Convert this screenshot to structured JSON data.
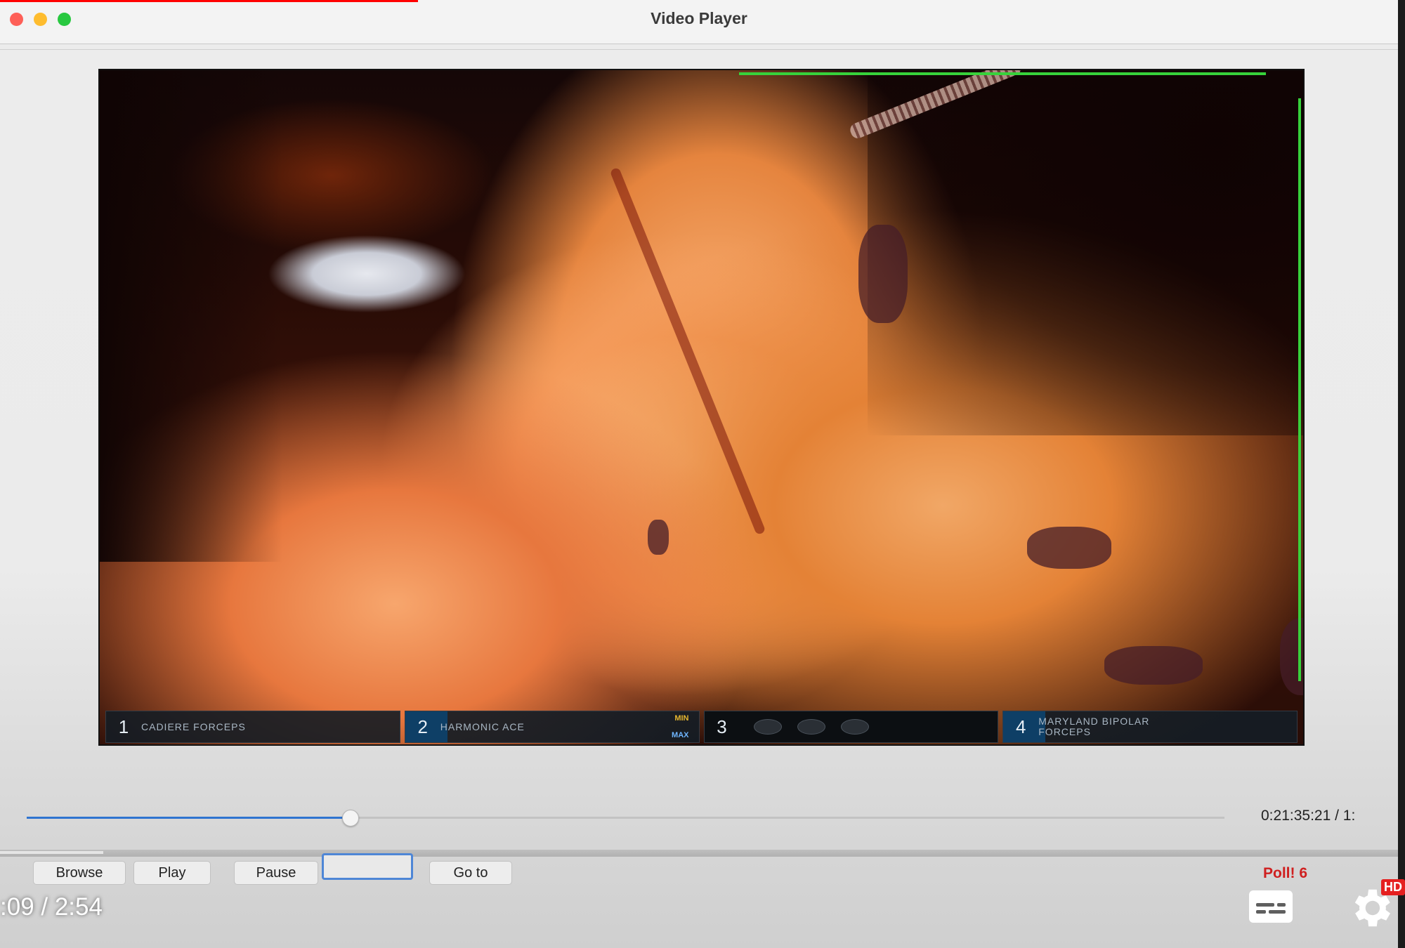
{
  "window": {
    "title": "Video Player"
  },
  "video": {
    "hud": [
      {
        "num": "1",
        "name": "CADIERE FORCEPS"
      },
      {
        "num": "2",
        "name": "HARMONIC ACE",
        "tag_top": "MIN",
        "tag_bottom": "MAX"
      },
      {
        "num": "3",
        "name": ""
      },
      {
        "num": "4",
        "name": "MARYLAND BIPOLAR\nFORCEPS"
      }
    ]
  },
  "playback": {
    "progress_fraction": 0.27,
    "timecode": "0:21:35:21 / 1:",
    "buttons": {
      "browse": "Browse",
      "play": "Play",
      "pause": "Pause",
      "goto": "Go to"
    },
    "goto_value": "",
    "poll_label": "Poll! 6"
  },
  "youtube": {
    "time": ":09 / 2:54",
    "hd_badge": "HD"
  },
  "colors": {
    "accent_blue": "#2f74d0",
    "poll_red": "#cf2020",
    "overlay_green": "#37d23b"
  }
}
